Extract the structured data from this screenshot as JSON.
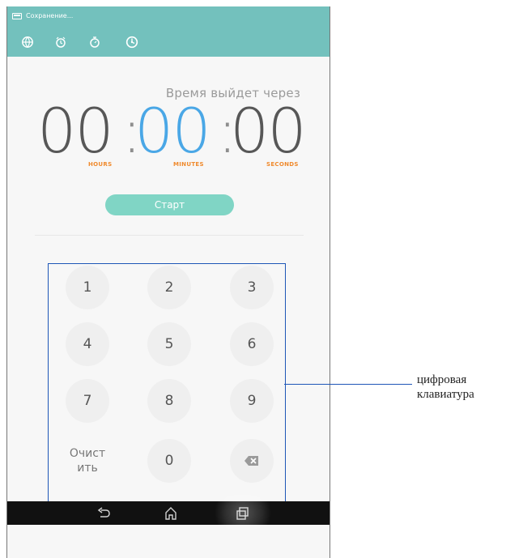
{
  "status_bar": {
    "text": "Сохранение...",
    "background": "#73c1bd",
    "icon": "screenshot-save-icon"
  },
  "toolbar": {
    "background": "#73c1bd",
    "icons": [
      "world-clock-icon",
      "alarm-icon",
      "stopwatch-icon",
      "timer-icon"
    ]
  },
  "timer": {
    "caption": "Время выйдет через",
    "hours": "00",
    "minutes": "00",
    "seconds": "00",
    "colon": ":",
    "labels": {
      "hours": "HOURS",
      "minutes": "MINUTES",
      "seconds": "SECONDS"
    },
    "accent_color": "#4aa7e6",
    "label_color": "#f08a2d"
  },
  "start_button": {
    "label": "Старт",
    "color": "#80d5c5"
  },
  "keypad": {
    "keys": [
      "1",
      "2",
      "3",
      "4",
      "5",
      "6",
      "7",
      "8",
      "9",
      "0"
    ],
    "clear_label": "Очист\nить",
    "backspace_icon": "backspace-icon"
  },
  "navigation": {
    "icons": [
      "back-icon",
      "home-icon",
      "recent-apps-icon"
    ],
    "background": "#111111"
  },
  "callout": {
    "label": "цифровая\nклавиатура",
    "line_color": "#1e56b7"
  }
}
